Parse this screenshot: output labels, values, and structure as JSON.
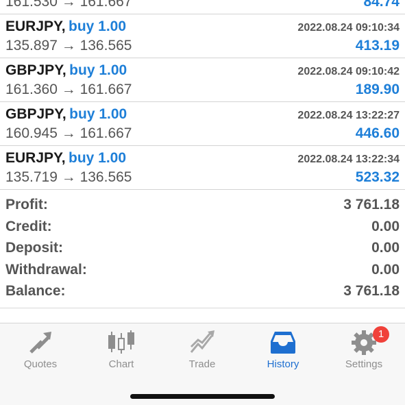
{
  "partial_top_deal": {
    "prices": "161.530 → 161.667",
    "profit": "84.74"
  },
  "deals": [
    {
      "symbol": "EURJPY,",
      "side": "buy 1.00",
      "time": "2022.08.24 09:10:34",
      "prices": "135.897 → 136.565",
      "profit": "413.19"
    },
    {
      "symbol": "GBPJPY,",
      "side": "buy 1.00",
      "time": "2022.08.24 09:10:42",
      "prices": "161.360 → 161.667",
      "profit": "189.90"
    },
    {
      "symbol": "GBPJPY,",
      "side": "buy 1.00",
      "time": "2022.08.24 13:22:27",
      "prices": "160.945 → 161.667",
      "profit": "446.60"
    },
    {
      "symbol": "EURJPY,",
      "side": "buy 1.00",
      "time": "2022.08.24 13:22:34",
      "prices": "135.719 → 136.565",
      "profit": "523.32"
    }
  ],
  "summary": [
    {
      "label": "Profit:",
      "value": "3 761.18"
    },
    {
      "label": "Credit:",
      "value": "0.00"
    },
    {
      "label": "Deposit:",
      "value": "0.00"
    },
    {
      "label": "Withdrawal:",
      "value": "0.00"
    },
    {
      "label": "Balance:",
      "value": "3 761.18"
    }
  ],
  "tabs": [
    {
      "label": "Quotes",
      "icon": "quotes-arrows-icon",
      "active": false
    },
    {
      "label": "Chart",
      "icon": "candlestick-chart-icon",
      "active": false
    },
    {
      "label": "Trade",
      "icon": "trade-zigzag-icon",
      "active": false
    },
    {
      "label": "History",
      "icon": "history-tray-icon",
      "active": true
    },
    {
      "label": "Settings",
      "icon": "gear-icon",
      "active": false,
      "badge": "1"
    }
  ],
  "colors": {
    "accent": "#1e7fd8",
    "active_tab": "#1e6fd0",
    "badge": "#f0413a",
    "text_dark": "#1a1a1a",
    "text_gray": "#555555"
  }
}
